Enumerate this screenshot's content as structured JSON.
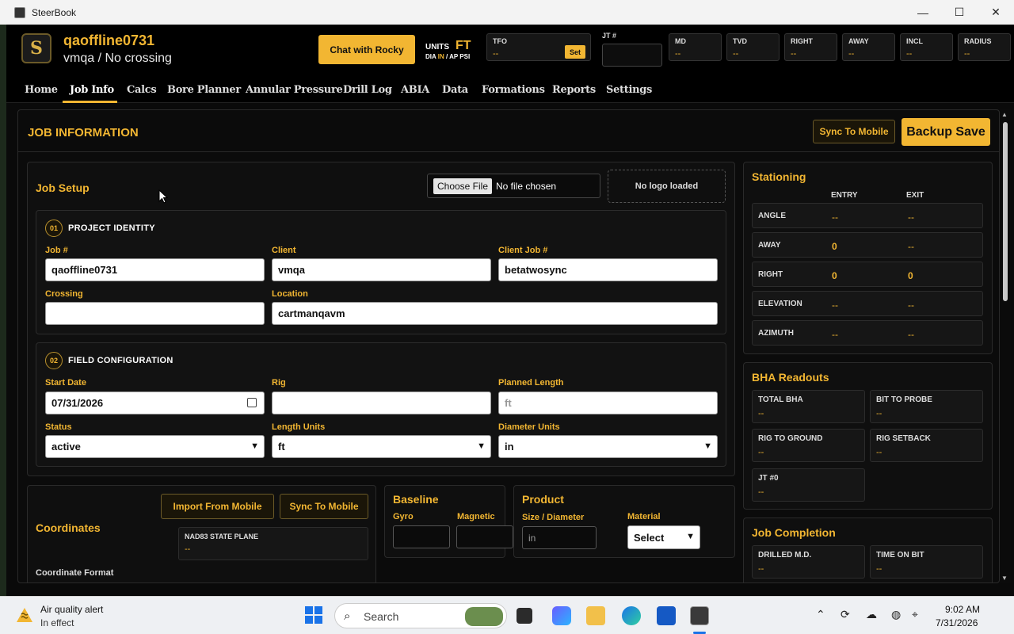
{
  "window": {
    "title": "SteerBook",
    "minimize": "—",
    "maximize": "☐",
    "close": "✕"
  },
  "header": {
    "logo_text": "S",
    "job_title": "qaoffline0731",
    "job_subtitle": "vmqa / No crossing",
    "chat_label": "Chat with Rocky",
    "units_label": "UNITS",
    "units_value": "FT",
    "units_dia": "DIA",
    "units_in": "IN",
    "units_ap": "/ AP PSI",
    "tfo": {
      "label": "TFO",
      "value": "--",
      "set_label": "Set"
    },
    "jt": {
      "label": "JT #",
      "value": ""
    },
    "readouts": [
      {
        "label": "MD",
        "value": "--"
      },
      {
        "label": "TVD",
        "value": "--"
      },
      {
        "label": "RIGHT",
        "value": "--"
      },
      {
        "label": "AWAY",
        "value": "--"
      },
      {
        "label": "INCL",
        "value": "--"
      },
      {
        "label": "RADIUS",
        "value": "--"
      }
    ]
  },
  "nav": {
    "items": [
      "Home",
      "Job Info",
      "Calcs",
      "Bore Planner",
      "Annular Pressure",
      "Drill Log",
      "ABIA",
      "Data",
      "Formations",
      "Reports",
      "Settings"
    ],
    "active": "Job Info"
  },
  "main": {
    "title": "JOB INFORMATION",
    "sync_label": "Sync To Mobile",
    "backup_label": "Backup Save"
  },
  "job_setup": {
    "title": "Job Setup",
    "file_button": "Choose File",
    "file_status": "No file chosen",
    "logo_status": "No logo loaded",
    "project": {
      "number": "01",
      "title": "PROJECT IDENTITY",
      "job_label": "Job #",
      "job_value": "qaoffline0731",
      "client_label": "Client",
      "client_value": "vmqa",
      "client_job_label": "Client Job #",
      "client_job_value": "betatwosync",
      "crossing_label": "Crossing",
      "crossing_value": "",
      "location_label": "Location",
      "location_value": "cartmanqavm"
    },
    "field": {
      "number": "02",
      "title": "FIELD CONFIGURATION",
      "start_label": "Start Date",
      "start_value": "07/31/2026",
      "rig_label": "Rig",
      "rig_value": "",
      "planned_label": "Planned Length",
      "planned_placeholder": "ft",
      "status_label": "Status",
      "status_value": "active",
      "length_units_label": "Length Units",
      "length_units_value": "ft",
      "diameter_units_label": "Diameter Units",
      "diameter_units_value": "in"
    }
  },
  "coordinates": {
    "title": "Coordinates",
    "import_label": "Import From Mobile",
    "sync_label": "Sync To Mobile",
    "nad_label": "NAD83 STATE PLANE",
    "nad_value": "--",
    "format_label": "Coordinate Format"
  },
  "baseline": {
    "title": "Baseline",
    "gyro_label": "Gyro",
    "magnetic_label": "Magnetic"
  },
  "product": {
    "title": "Product",
    "size_label": "Size / Diameter",
    "size_placeholder": "in",
    "material_label": "Material",
    "material_value": "Select"
  },
  "stationing": {
    "title": "Stationing",
    "entry_label": "ENTRY",
    "exit_label": "EXIT",
    "rows": [
      {
        "label": "ANGLE",
        "entry": "--",
        "exit": "--"
      },
      {
        "label": "AWAY",
        "entry": "0",
        "exit": "--"
      },
      {
        "label": "RIGHT",
        "entry": "0",
        "exit": "0"
      },
      {
        "label": "ELEVATION",
        "entry": "--",
        "exit": "--"
      },
      {
        "label": "AZIMUTH",
        "entry": "--",
        "exit": "--"
      }
    ]
  },
  "bha": {
    "title": "BHA Readouts",
    "cards": [
      {
        "label": "TOTAL BHA",
        "value": "--"
      },
      {
        "label": "BIT TO PROBE",
        "value": "--"
      },
      {
        "label": "RIG TO GROUND",
        "value": "--"
      },
      {
        "label": "RIG SETBACK",
        "value": "--"
      },
      {
        "label": "JT #0",
        "value": "--"
      }
    ]
  },
  "completion": {
    "title": "Job Completion",
    "cards": [
      {
        "label": "DRILLED M.D.",
        "value": "--"
      },
      {
        "label": "TIME ON BIT",
        "value": "--"
      }
    ]
  },
  "taskbar": {
    "alert_title": "Air quality alert",
    "alert_sub": "In effect",
    "search_text": "Search",
    "time": "9:02 AM",
    "date": "7/31/2026",
    "tray_icons": [
      "chevron-up-icon",
      "sync-icon",
      "cloud-off-icon",
      "globe-icon",
      "location-icon"
    ]
  },
  "colors": {
    "accent": "#f2b632",
    "background": "#0a0a0a",
    "panel": "#121212"
  }
}
